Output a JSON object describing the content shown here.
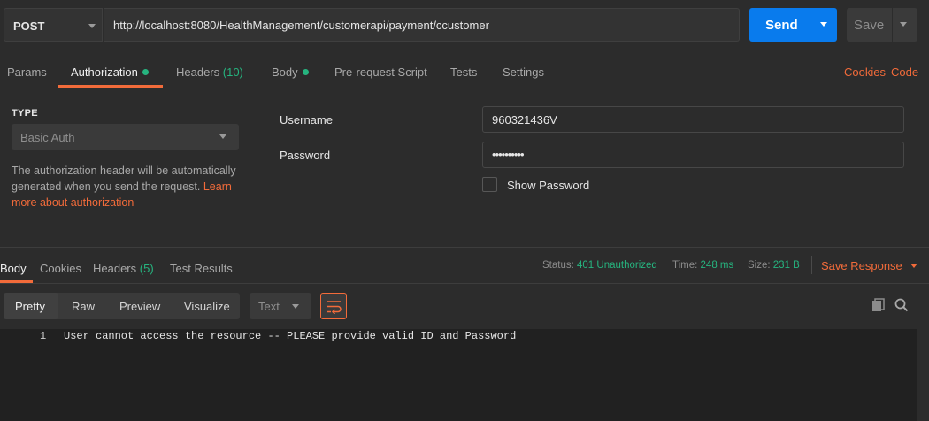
{
  "request": {
    "method": "POST",
    "url": "http://localhost:8080/HealthManagement/customerapi/payment/ccustomer",
    "send_label": "Send",
    "save_label": "Save"
  },
  "tabs": [
    {
      "label": "Params"
    },
    {
      "label": "Authorization"
    },
    {
      "label": "Headers",
      "count": "(10)"
    },
    {
      "label": "Body"
    },
    {
      "label": "Pre-request Script"
    },
    {
      "label": "Tests"
    },
    {
      "label": "Settings"
    }
  ],
  "links": {
    "cookies": "Cookies",
    "code": "Code"
  },
  "auth": {
    "type_heading": "TYPE",
    "type_value": "Basic Auth",
    "description": "The authorization header will be automatically generated when you send the request.",
    "learn_more": "Learn more about authorization",
    "username_label": "Username",
    "username_value": "960321436V",
    "password_label": "Password",
    "password_value": "••••••••••",
    "show_password": "Show Password"
  },
  "response": {
    "tabs": [
      {
        "label": "Body"
      },
      {
        "label": "Cookies"
      },
      {
        "label": "Headers",
        "count": "(5)"
      },
      {
        "label": "Test Results"
      }
    ],
    "status_label": "Status:",
    "status_value": "401 Unauthorized",
    "time_label": "Time:",
    "time_value": "248 ms",
    "size_label": "Size:",
    "size_value": "231 B",
    "save_response": "Save Response",
    "view_modes": [
      "Pretty",
      "Raw",
      "Preview",
      "Visualize"
    ],
    "format": "Text",
    "lines": [
      {
        "number": "1",
        "text": "User cannot access the resource -- PLEASE provide valid ID and Password"
      }
    ]
  },
  "colors": {
    "accent": "#f26b3a",
    "send": "#097bed",
    "success": "#26b47f",
    "background": "#2c2c2c"
  }
}
